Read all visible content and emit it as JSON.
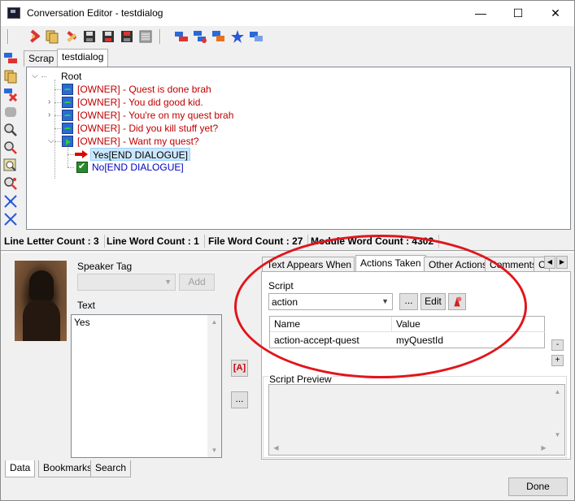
{
  "window": {
    "title": "Conversation Editor - testdialog",
    "minimize_glyph": "—",
    "maximize_glyph": "☐",
    "close_glyph": "✕"
  },
  "toolbar": {
    "icons": [
      "cut-icon",
      "copy-icon",
      "paste-icon",
      "save-icon",
      "save-all-icon",
      "save-as-icon",
      "properties-icon",
      "add-node-icon",
      "add-link-icon",
      "copy-node-icon",
      "star-icon",
      "link-icon"
    ]
  },
  "left_tools": {
    "icons": [
      "add-entry-icon",
      "paste-node-icon",
      "delete-node-icon",
      "disabled-node-icon",
      "find-icon",
      "find-next-icon",
      "zoom-icon",
      "find-replace-icon",
      "expand-icon",
      "collapse-icon"
    ]
  },
  "top_tabs": [
    {
      "label": "Scrap",
      "active": false
    },
    {
      "label": "testdialog",
      "active": true
    }
  ],
  "tree": {
    "root_label": "Root",
    "nodes": [
      {
        "text": "[OWNER] - Quest is done brah",
        "color": "red",
        "icon": "npc-node-icon",
        "expandable": false
      },
      {
        "text": "[OWNER] - You did good kid.",
        "color": "red",
        "icon": "npc-node-icon",
        "expandable": true
      },
      {
        "text": "[OWNER] - You're on my quest brah",
        "color": "red",
        "icon": "npc-node-icon",
        "expandable": true
      },
      {
        "text": "[OWNER] - Did you kill stuff yet?",
        "color": "red",
        "icon": "npc-node-icon",
        "expandable": false
      },
      {
        "text": "[OWNER] - Want my quest?",
        "color": "red",
        "icon": "npc-node-play-icon",
        "expandable": true,
        "expanded": true
      }
    ],
    "children": [
      {
        "text": "Yes[END DIALOGUE]",
        "color": "black",
        "icon": "red-arrow-icon",
        "selected": true
      },
      {
        "text": "No[END DIALOGUE]",
        "color": "blue",
        "icon": "check-node-icon",
        "selected": false
      }
    ]
  },
  "status": {
    "line_letter": "Line Letter Count : 3",
    "line_word": "Line Word Count : 1",
    "file_word": "File Word Count : 27",
    "module_word": "Module Word Count : 4302"
  },
  "speaker": {
    "tag_label": "Speaker Tag",
    "tag_value": "",
    "add_label": "Add",
    "text_label": "Text",
    "text_value": "Yes"
  },
  "side_buttons": {
    "insert_token_label": "[A]",
    "more_label": "..."
  },
  "right_tabs": [
    {
      "label": "Text Appears When ...",
      "active": false
    },
    {
      "label": "Actions Taken",
      "active": true
    },
    {
      "label": "Other Actions",
      "active": false
    },
    {
      "label": "Comments",
      "active": false
    },
    {
      "label": "C",
      "active": false
    }
  ],
  "actions": {
    "script_label": "Script",
    "script_value": "action",
    "browse_label": "...",
    "edit_label": "Edit",
    "params_headers": [
      "Name",
      "Value"
    ],
    "params": [
      {
        "name": "action-accept-quest",
        "value": "myQuestId"
      }
    ],
    "minus_label": "-",
    "plus_label": "+",
    "preview_label": "Script Preview"
  },
  "bottom_tabs": [
    {
      "label": "Data",
      "active": true
    },
    {
      "label": "Bookmarks",
      "active": false
    },
    {
      "label": "Search",
      "active": false
    }
  ],
  "done_label": "Done",
  "colors": {
    "npc_text": "#c00000",
    "pc_text": "#0000c0",
    "annotation": "#e0161c",
    "selection": "#cce8ff"
  }
}
